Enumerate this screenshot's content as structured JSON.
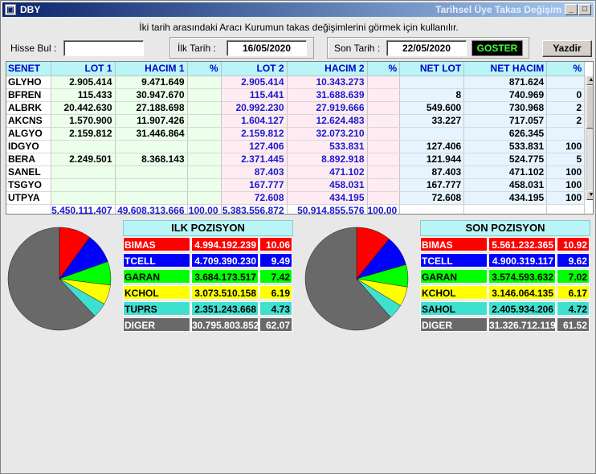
{
  "window": {
    "title": "DBY",
    "right_title": "Tarihsel Üye Takas Değişim"
  },
  "subtitle": "İki tarih arasındaki  Aracı Kurumun takas değişimlerini görmek için kullanılır.",
  "toolbar": {
    "hisse_label": "Hisse Bul :",
    "hisse_value": "",
    "ilk_label": "İlk Tarih :",
    "ilk_value": "16/05/2020",
    "son_label": "Son Tarih :",
    "son_value": "22/05/2020",
    "goster_label": "GOSTER",
    "yazdir_label": "Yazdir"
  },
  "grid": {
    "headers": [
      "SENET",
      "LOT 1",
      "HACIM 1",
      "%",
      "LOT 2",
      "HACIM 2",
      "%",
      "NET LOT",
      "NET HACIM",
      "%"
    ],
    "rows": [
      [
        "GLYHO",
        "2.905.414",
        "9.471.649",
        "",
        "2.905.414",
        "10.343.273",
        "",
        "",
        "871.624",
        ""
      ],
      [
        "BFREN",
        "115.433",
        "30.947.670",
        "",
        "115.441",
        "31.688.639",
        "",
        "8",
        "740.969",
        "0"
      ],
      [
        "ALBRK",
        "20.442.630",
        "27.188.698",
        "",
        "20.992.230",
        "27.919.666",
        "",
        "549.600",
        "730.968",
        "2"
      ],
      [
        "AKCNS",
        "1.570.900",
        "11.907.426",
        "",
        "1.604.127",
        "12.624.483",
        "",
        "33.227",
        "717.057",
        "2"
      ],
      [
        "ALGYO",
        "2.159.812",
        "31.446.864",
        "",
        "2.159.812",
        "32.073.210",
        "",
        "",
        "626.345",
        ""
      ],
      [
        "IDGYO",
        "",
        "",
        "",
        "127.406",
        "533.831",
        "",
        "127.406",
        "533.831",
        "100"
      ],
      [
        "BERA",
        "2.249.501",
        "8.368.143",
        "",
        "2.371.445",
        "8.892.918",
        "",
        "121.944",
        "524.775",
        "5"
      ],
      [
        "SANEL",
        "",
        "",
        "",
        "87.403",
        "471.102",
        "",
        "87.403",
        "471.102",
        "100"
      ],
      [
        "TSGYO",
        "",
        "",
        "",
        "167.777",
        "458.031",
        "",
        "167.777",
        "458.031",
        "100"
      ],
      [
        "UTPYA",
        "",
        "",
        "",
        "72.608",
        "434.195",
        "",
        "72.608",
        "434.195",
        "100"
      ]
    ],
    "totals": [
      "",
      "5.450.111.407",
      "49.608.313.666",
      "100,00",
      "5.383.556.872",
      "50.914.855.576",
      "100,00",
      "",
      "",
      ""
    ]
  },
  "ilk_pozisyon": {
    "title": "ILK POZISYON",
    "rows": [
      {
        "name": "BIMAS",
        "value": "4.994.192.239",
        "pct": "10.06",
        "pct_num": 10.06,
        "bg": "#ff0000",
        "fg": "#ffffff"
      },
      {
        "name": "TCELL",
        "value": "4.709.390.230",
        "pct": "9.49",
        "pct_num": 9.49,
        "bg": "#0000ff",
        "fg": "#ffffff"
      },
      {
        "name": "GARAN",
        "value": "3.684.173.517",
        "pct": "7.42",
        "pct_num": 7.42,
        "bg": "#00ff00",
        "fg": "#000000"
      },
      {
        "name": "KCHOL",
        "value": "3.073.510.158",
        "pct": "6.19",
        "pct_num": 6.19,
        "bg": "#ffff00",
        "fg": "#000000"
      },
      {
        "name": "TUPRS",
        "value": "2.351.243.668",
        "pct": "4.73",
        "pct_num": 4.73,
        "bg": "#40e0d0",
        "fg": "#000000"
      },
      {
        "name": "DIGER",
        "value": "30.795.803.852",
        "pct": "62.07",
        "pct_num": 62.07,
        "bg": "#696969",
        "fg": "#ffffff"
      }
    ]
  },
  "son_pozisyon": {
    "title": "SON POZISYON",
    "rows": [
      {
        "name": "BIMAS",
        "value": "5.561.232.365",
        "pct": "10.92",
        "pct_num": 10.92,
        "bg": "#ff0000",
        "fg": "#ffffff"
      },
      {
        "name": "TCELL",
        "value": "4.900.319.117",
        "pct": "9.62",
        "pct_num": 9.62,
        "bg": "#0000ff",
        "fg": "#ffffff"
      },
      {
        "name": "GARAN",
        "value": "3.574.593.632",
        "pct": "7.02",
        "pct_num": 7.02,
        "bg": "#00ff00",
        "fg": "#000000"
      },
      {
        "name": "KCHOL",
        "value": "3.146.064.135",
        "pct": "6.17",
        "pct_num": 6.17,
        "bg": "#ffff00",
        "fg": "#000000"
      },
      {
        "name": "SAHOL",
        "value": "2.405.934.206",
        "pct": "4.72",
        "pct_num": 4.72,
        "bg": "#40e0d0",
        "fg": "#000000"
      },
      {
        "name": "DIGER",
        "value": "31.326.712.119",
        "pct": "61.52",
        "pct_num": 61.52,
        "bg": "#696969",
        "fg": "#ffffff"
      }
    ]
  }
}
